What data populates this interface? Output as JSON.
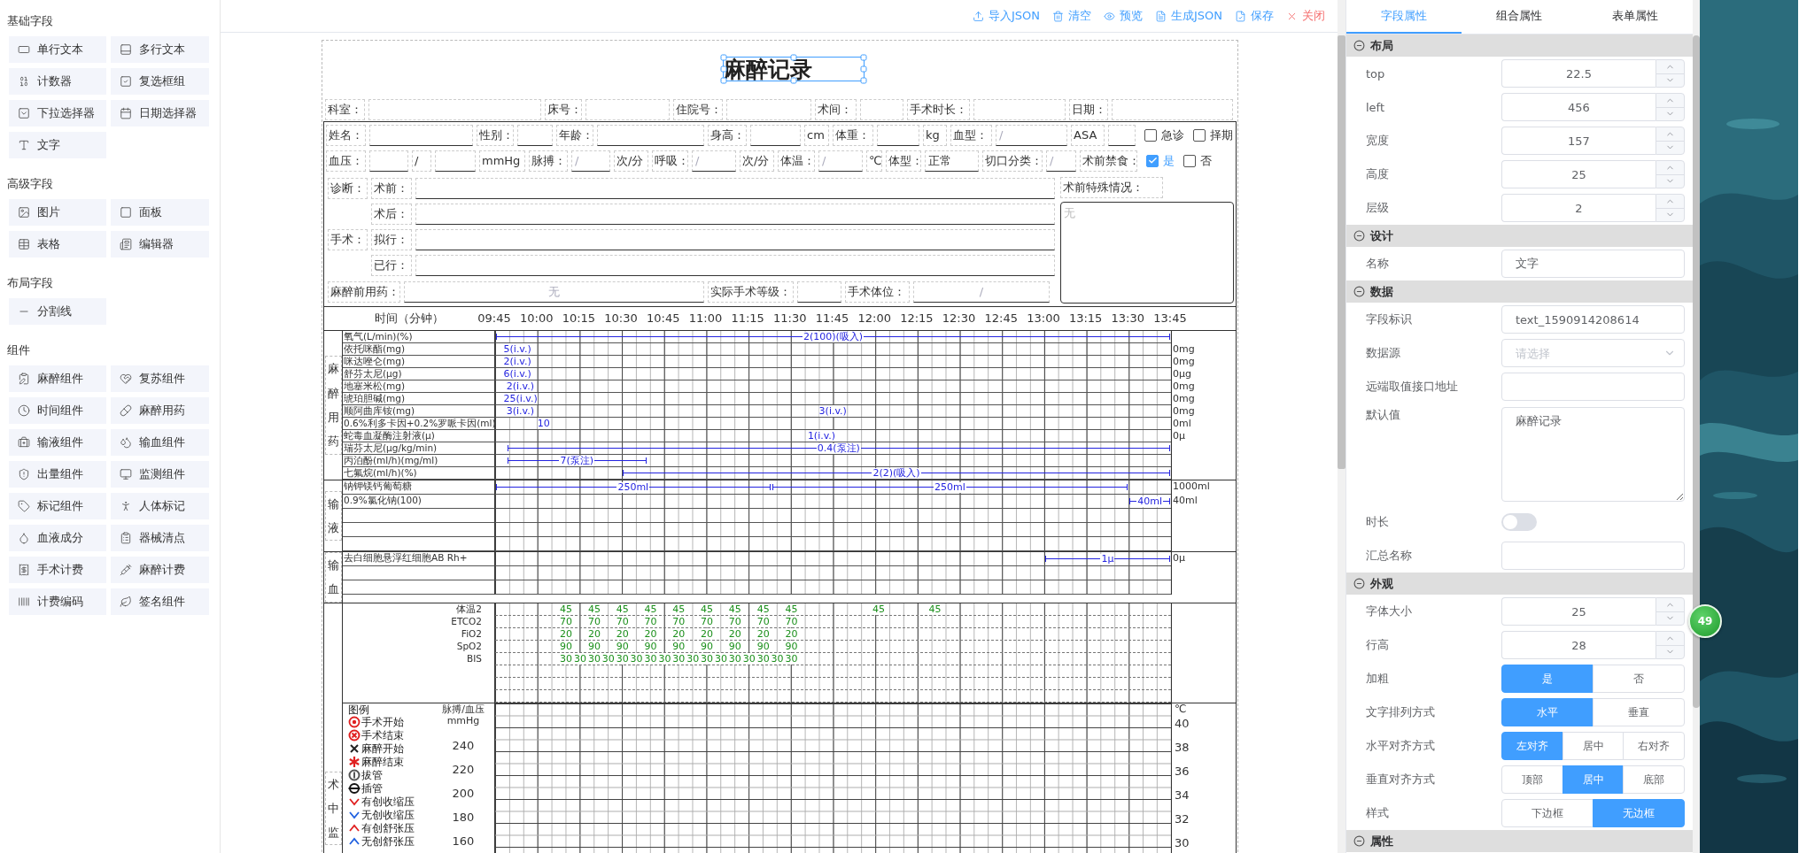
{
  "sidebar": {
    "sections": [
      {
        "title": "基础字段",
        "items": [
          "单行文本",
          "多行文本",
          "计数器",
          "复选框组",
          "下拉选择器",
          "日期选择器",
          "文字"
        ]
      },
      {
        "title": "高级字段",
        "items": [
          "图片",
          "面板",
          "表格",
          "编辑器"
        ]
      },
      {
        "title": "布局字段",
        "items": [
          "分割线"
        ]
      },
      {
        "title": "组件",
        "items": [
          "麻醉组件",
          "复苏组件",
          "时间组件",
          "麻醉用药",
          "输液组件",
          "输血组件",
          "出量组件",
          "监测组件",
          "标记组件",
          "人体标记",
          "血液成分",
          "器械清点",
          "手术计费",
          "麻醉计费",
          "计费编码",
          "签名组件"
        ]
      }
    ]
  },
  "toolbar": [
    {
      "kind": "import",
      "label": "导入JSON"
    },
    {
      "kind": "clear",
      "label": "清空"
    },
    {
      "kind": "preview",
      "label": "预览"
    },
    {
      "kind": "generate",
      "label": "生成JSON"
    },
    {
      "kind": "save",
      "label": "保存"
    },
    {
      "kind": "close",
      "label": "关闭"
    }
  ],
  "form": {
    "title": {
      "text": "麻醉记录",
      "selected": true
    },
    "info_rows": [
      [
        {
          "kind": "label",
          "text": "科室："
        },
        {
          "kind": "field"
        },
        {
          "kind": "label",
          "text": "床号："
        },
        {
          "kind": "field"
        },
        {
          "kind": "label",
          "text": "住院号："
        },
        {
          "kind": "field"
        },
        {
          "kind": "label",
          "text": "术间："
        },
        {
          "kind": "field"
        },
        {
          "kind": "label",
          "text": "手术时长："
        },
        {
          "kind": "field"
        },
        {
          "kind": "label",
          "text": "日期："
        },
        {
          "kind": "field"
        }
      ],
      [
        {
          "kind": "label",
          "text": "姓名："
        },
        {
          "kind": "field"
        },
        {
          "kind": "label",
          "text": "性别："
        },
        {
          "kind": "field"
        },
        {
          "kind": "label",
          "text": "年龄："
        },
        {
          "kind": "field"
        },
        {
          "kind": "label",
          "text": "身高："
        },
        {
          "kind": "field"
        },
        {
          "kind": "unit",
          "text": "cm"
        },
        {
          "kind": "label",
          "text": "体重："
        },
        {
          "kind": "field"
        },
        {
          "kind": "unit",
          "text": "kg"
        },
        {
          "kind": "label",
          "text": "血型："
        },
        {
          "kind": "field",
          "placeholder": "/"
        },
        {
          "kind": "label",
          "text": "ASA"
        },
        {
          "kind": "field"
        },
        {
          "kind": "check",
          "text": "急诊",
          "checked": false
        },
        {
          "kind": "check",
          "text": "择期",
          "checked": false
        }
      ],
      [
        {
          "kind": "label",
          "text": "血压："
        },
        {
          "kind": "field"
        },
        {
          "kind": "unit",
          "text": "/"
        },
        {
          "kind": "field"
        },
        {
          "kind": "unit",
          "text": "mmHg"
        },
        {
          "kind": "label",
          "text": "脉搏："
        },
        {
          "kind": "field",
          "placeholder": "/"
        },
        {
          "kind": "unit",
          "text": "次/分"
        },
        {
          "kind": "label",
          "text": "呼吸："
        },
        {
          "kind": "field",
          "placeholder": "/"
        },
        {
          "kind": "unit",
          "text": "次/分"
        },
        {
          "kind": "label",
          "text": "体温："
        },
        {
          "kind": "field",
          "placeholder": "/"
        },
        {
          "kind": "unit",
          "text": "℃"
        },
        {
          "kind": "label",
          "text": "体型："
        },
        {
          "kind": "field",
          "value": "正常"
        },
        {
          "kind": "label",
          "text": "切口分类："
        },
        {
          "kind": "field",
          "placeholder": "/"
        },
        {
          "kind": "label",
          "text": "术前禁食："
        },
        {
          "kind": "check",
          "text": "是",
          "checked": true
        },
        {
          "kind": "check",
          "text": "否",
          "checked": false
        }
      ]
    ],
    "notes": {
      "groups": [
        {
          "label": "诊断：",
          "items": [
            {
              "label": "术前："
            },
            {
              "label": "术后："
            }
          ]
        },
        {
          "label": "手术：",
          "items": [
            {
              "label": "拟行："
            },
            {
              "label": "已行："
            }
          ]
        }
      ],
      "premed": [
        {
          "kind": "label",
          "text": "麻醉前用药："
        },
        {
          "kind": "field",
          "placeholder": "无"
        },
        {
          "kind": "label",
          "text": "实际手术等级："
        },
        {
          "kind": "field"
        },
        {
          "kind": "label",
          "text": "手术体位："
        },
        {
          "kind": "field",
          "placeholder": "/"
        }
      ],
      "special": {
        "label": "术前特殊情况：",
        "placeholder": "无"
      }
    },
    "timeline": {
      "label": "时间（分钟）",
      "times": [
        "09:45",
        "10:00",
        "10:15",
        "10:30",
        "10:45",
        "11:00",
        "11:15",
        "11:30",
        "11:45",
        "12:00",
        "12:15",
        "12:30",
        "12:45",
        "13:00",
        "13:15",
        "13:30",
        "13:45"
      ]
    },
    "drugs": {
      "title": "麻醉用药",
      "rows": [
        {
          "name": "氧气(L/min)(%)",
          "marks": [
            {
              "kind": "line",
              "text": "2(100)(吸入)"
            }
          ]
        },
        {
          "name": "依托咪酯(mg)",
          "marks": [
            {
              "kind": "dose",
              "text": "5(i.v.)"
            }
          ],
          "total": "0mg"
        },
        {
          "name": "咪达唑仑(mg)",
          "marks": [
            {
              "kind": "dose",
              "text": "2(i.v.)"
            }
          ],
          "total": "0mg"
        },
        {
          "name": "舒芬太尼(μg)",
          "marks": [
            {
              "kind": "dose",
              "text": "6(i.v.)"
            }
          ],
          "total": "0μg"
        },
        {
          "name": "地塞米松(mg)",
          "marks": [
            {
              "kind": "dose",
              "text": "2(i.v.)"
            }
          ],
          "total": "0mg"
        },
        {
          "name": "琥珀胆碱(mg)",
          "marks": [
            {
              "kind": "dose",
              "text": "25(i.v.)"
            }
          ],
          "total": "0mg"
        },
        {
          "name": "顺阿曲库铵(mg)",
          "marks": [
            {
              "kind": "dose",
              "text": "3(i.v.)"
            },
            {
              "kind": "dose",
              "text": "3(i.v.)"
            }
          ],
          "total": "0mg"
        },
        {
          "name": "0.6%利多卡因+0.2%罗哌卡因(ml)",
          "marks": [
            {
              "kind": "dose",
              "text": "10"
            }
          ],
          "total": "0ml"
        },
        {
          "name": "蛇毒血凝酶注射液(μ)",
          "marks": [
            {
              "kind": "dose",
              "text": "1(i.v.)"
            }
          ],
          "total": "0μ"
        },
        {
          "name": "瑞芬太尼(μg/kg/min)",
          "marks": [
            {
              "kind": "line",
              "text": "0.4(泵注)"
            }
          ]
        },
        {
          "name": "丙泊酚(ml/h)(mg/ml)",
          "marks": [
            {
              "kind": "line",
              "text": "7(泵注)"
            }
          ]
        },
        {
          "name": "七氟烷(ml/h)(%)",
          "marks": [
            {
              "kind": "line",
              "text": "2(2)(吸入)"
            }
          ]
        }
      ]
    },
    "fluids": {
      "title": "输液",
      "rows": [
        {
          "name": "钠钾镁钙葡萄糖",
          "marks": [
            {
              "kind": "line",
              "text": "250ml"
            },
            {
              "kind": "line",
              "text": "250ml"
            }
          ],
          "total": "1000ml"
        },
        {
          "name": "0.9%氯化钠(100)",
          "marks": [
            {
              "kind": "line",
              "text": "40ml"
            }
          ],
          "total": "40ml"
        }
      ]
    },
    "blood": {
      "title": "输血",
      "rows": [
        {
          "name": "去白细胞悬浮红细胞AB Rh+",
          "marks": [
            {
              "kind": "line",
              "text": "1μ"
            }
          ],
          "total": "0μ"
        }
      ]
    },
    "monitoring": {
      "title": "术中监",
      "vitals": [
        {
          "label": "体温2",
          "values": [
            "45",
            "45",
            "45",
            "45",
            "45",
            "45",
            "45",
            "45",
            "45",
            "45",
            "45"
          ]
        },
        {
          "label": "ETCO2",
          "values": [
            "70",
            "70",
            "70",
            "70",
            "70",
            "70",
            "70",
            "70",
            "70"
          ]
        },
        {
          "label": "FiO2",
          "values": [
            "20",
            "20",
            "20",
            "20",
            "20",
            "20",
            "20",
            "20",
            "20"
          ]
        },
        {
          "label": "SpO2",
          "values": [
            "90",
            "90",
            "90",
            "90",
            "90",
            "90",
            "90",
            "90",
            "90"
          ]
        },
        {
          "label": "BIS",
          "values": [
            "30",
            "30",
            "30",
            "30",
            "30",
            "30",
            "30",
            "30",
            "30",
            "30",
            "30",
            "30",
            "30",
            "30",
            "30",
            "30",
            "30"
          ]
        }
      ],
      "legend": {
        "title": "图例",
        "items": [
          {
            "kind": "target",
            "color": "#e02020",
            "label": "手术开始"
          },
          {
            "kind": "circle-x",
            "color": "#e02020",
            "label": "手术结束"
          },
          {
            "kind": "cross",
            "color": "#222222",
            "label": "麻醉开始"
          },
          {
            "kind": "asterisk",
            "color": "#e02020",
            "label": "麻醉结束"
          },
          {
            "kind": "circle-bar",
            "color": "#555555",
            "label": "拔管"
          },
          {
            "kind": "circle-line",
            "color": "#111111",
            "label": "插管"
          },
          {
            "kind": "check",
            "color": "#e02020",
            "label": "有创收缩压"
          },
          {
            "kind": "check",
            "color": "#2060e0",
            "label": "无创收缩压"
          },
          {
            "kind": "caret",
            "color": "#e02020",
            "label": "有创舒张压"
          },
          {
            "kind": "caret",
            "color": "#2060e0",
            "label": "无创舒张压"
          }
        ]
      },
      "left_axis": {
        "title": "脉搏/血压",
        "unit": "mmHg",
        "ticks": [
          "240",
          "220",
          "200",
          "180",
          "160"
        ]
      },
      "right_axis": {
        "unit": "℃",
        "ticks": [
          "40",
          "38",
          "36",
          "34",
          "32",
          "30"
        ]
      }
    }
  },
  "panel": {
    "tabs": [
      {
        "label": "字段属性",
        "selected": true
      },
      {
        "label": "组合属性",
        "selected": false
      },
      {
        "label": "表单属性",
        "selected": false
      }
    ],
    "sections": [
      {
        "title": "布局",
        "rows": [
          {
            "kind": "number",
            "label": "top",
            "value": "22.5"
          },
          {
            "kind": "number",
            "label": "left",
            "value": "456"
          },
          {
            "kind": "number",
            "label": "宽度",
            "value": "157"
          },
          {
            "kind": "number",
            "label": "高度",
            "value": "25"
          },
          {
            "kind": "number",
            "label": "层级",
            "value": "2"
          }
        ]
      },
      {
        "title": "设计",
        "rows": [
          {
            "kind": "text",
            "label": "名称",
            "value": "文字"
          }
        ]
      },
      {
        "title": "数据",
        "rows": [
          {
            "kind": "text",
            "label": "字段标识",
            "value": "text_1590914208614"
          },
          {
            "kind": "select",
            "label": "数据源",
            "placeholder": "请选择"
          },
          {
            "kind": "text",
            "label": "远端取值接口地址"
          },
          {
            "kind": "textarea",
            "label": "默认值",
            "value": "麻醉记录"
          },
          {
            "kind": "switch",
            "label": "时长",
            "on": false
          },
          {
            "kind": "text",
            "label": "汇总名称"
          }
        ]
      },
      {
        "title": "外观",
        "rows": [
          {
            "kind": "number",
            "label": "字体大小",
            "value": "25"
          },
          {
            "kind": "number",
            "label": "行高",
            "value": "28"
          },
          {
            "kind": "segmented",
            "label": "加粗",
            "options": [
              {
                "label": "是",
                "selected": true
              },
              {
                "label": "否",
                "selected": false
              }
            ]
          },
          {
            "kind": "segmented",
            "label": "文字排列方式",
            "options": [
              {
                "label": "水平",
                "selected": true
              },
              {
                "label": "垂直",
                "selected": false
              }
            ]
          },
          {
            "kind": "segmented",
            "label": "水平对齐方式",
            "options": [
              {
                "label": "左对齐",
                "selected": true
              },
              {
                "label": "居中",
                "selected": false
              },
              {
                "label": "右对齐",
                "selected": false
              }
            ]
          },
          {
            "kind": "segmented",
            "label": "垂直对齐方式",
            "options": [
              {
                "label": "顶部",
                "selected": false
              },
              {
                "label": "居中",
                "selected": true
              },
              {
                "label": "底部",
                "selected": false
              }
            ]
          },
          {
            "kind": "segmented",
            "label": "样式",
            "options": [
              {
                "label": "下边框",
                "selected": false
              },
              {
                "label": "无边框",
                "selected": true
              }
            ]
          }
        ]
      },
      {
        "title": "属性"
      }
    ]
  },
  "badge": "49"
}
